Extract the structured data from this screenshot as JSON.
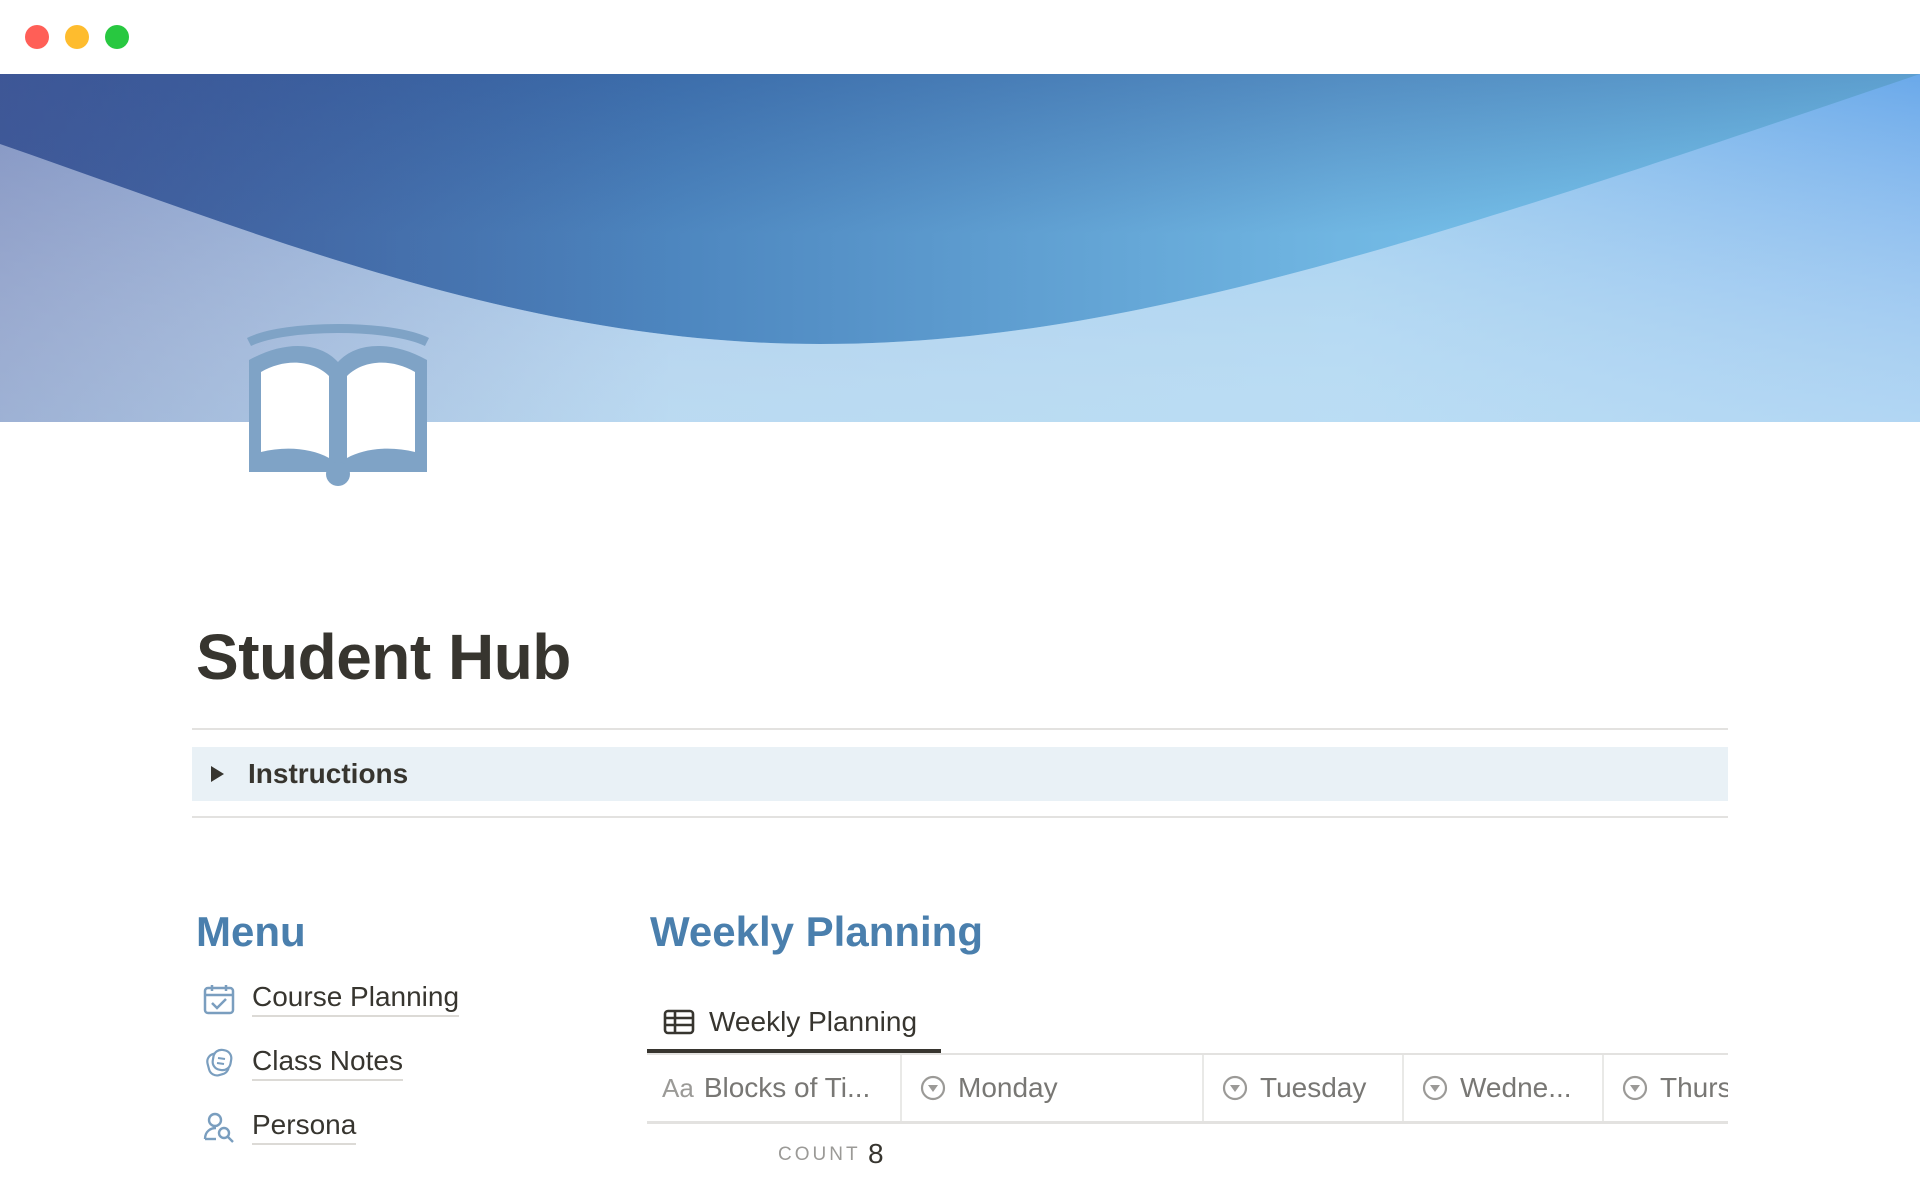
{
  "window": {
    "traffic_lights": [
      "close",
      "minimize",
      "zoom"
    ]
  },
  "page": {
    "icon": "open-book-icon",
    "title": "Student Hub"
  },
  "toggle": {
    "label": "Instructions",
    "state": "collapsed"
  },
  "menu": {
    "heading": "Menu",
    "items": [
      {
        "label": "Course Planning",
        "icon": "calendar-check-icon"
      },
      {
        "label": "Class Notes",
        "icon": "notes-icon"
      },
      {
        "label": "Persona",
        "icon": "person-search-icon"
      }
    ]
  },
  "weekly_planning": {
    "heading": "Weekly Planning",
    "view_tab": {
      "label": "Weekly Planning",
      "icon": "table-icon"
    },
    "columns": [
      {
        "type_label": "Aa",
        "label": "Blocks of Ti...",
        "icon": "title-icon"
      },
      {
        "label": "Monday",
        "icon": "select-icon"
      },
      {
        "label": "Tuesday",
        "icon": "select-icon"
      },
      {
        "label": "Wedne...",
        "icon": "select-icon"
      },
      {
        "label": "Thurs",
        "icon": "select-icon"
      }
    ],
    "count_label": "COUNT",
    "count_value": "8"
  },
  "colors": {
    "heading_accent": "#4a7fad",
    "toggle_background": "#e9f1f6",
    "icon_blue": "#7a9ebf"
  }
}
